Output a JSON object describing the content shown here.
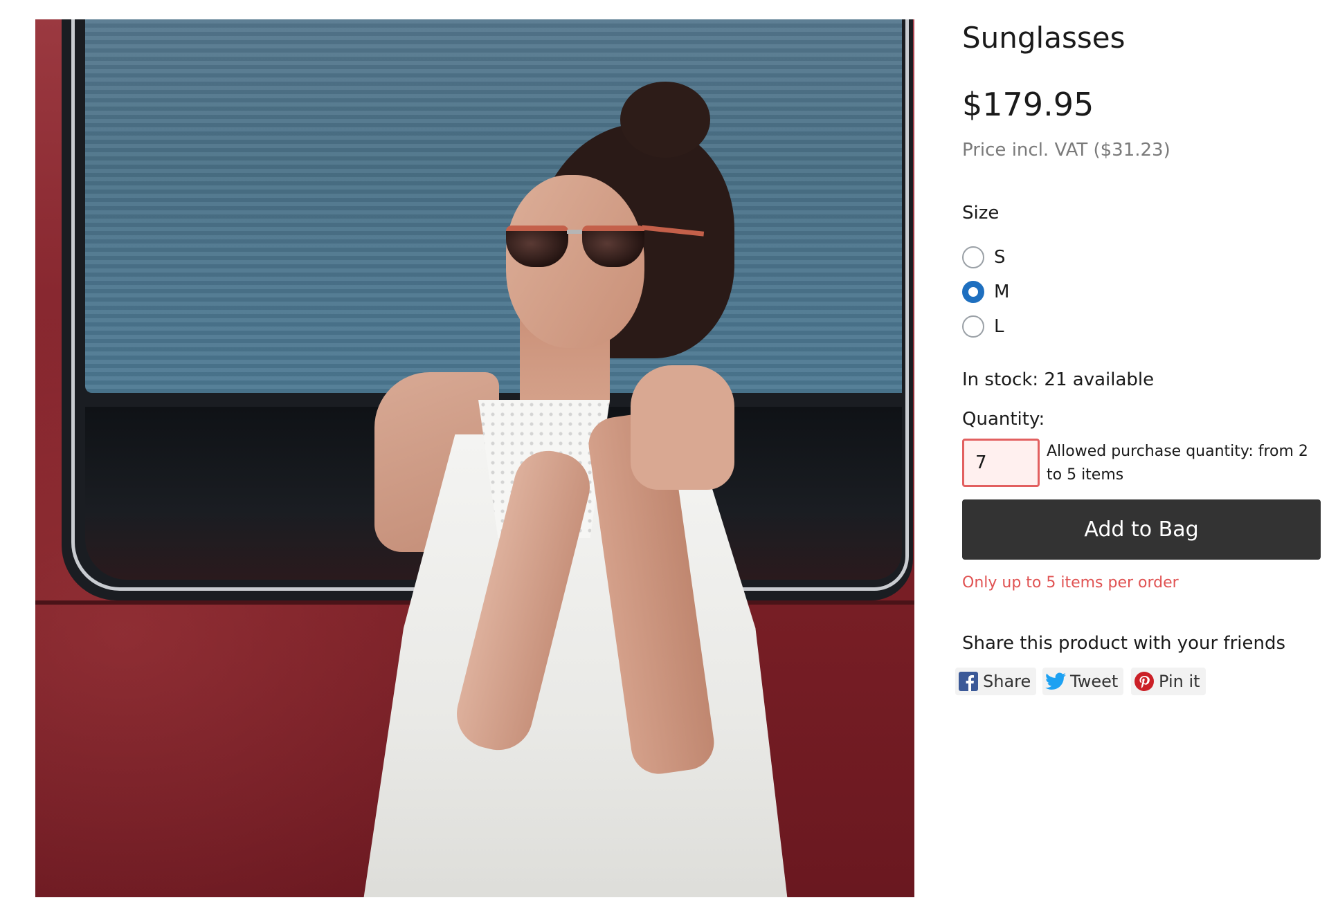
{
  "product": {
    "title": "Sunglasses",
    "price": "$179.95",
    "vat_note": "Price incl. VAT ($31.23)",
    "image_alt": "Woman in white dress wearing sunglasses leaning against a red van"
  },
  "size": {
    "label": "Size",
    "options": [
      {
        "label": "S",
        "selected": false
      },
      {
        "label": "M",
        "selected": true
      },
      {
        "label": "L",
        "selected": false
      }
    ]
  },
  "stock": {
    "text": "In stock: 21 available"
  },
  "quantity": {
    "label": "Quantity:",
    "value": "7",
    "hint": "Allowed purchase quantity: from 2 to 5 items"
  },
  "cart": {
    "add_label": "Add to Bag",
    "error": "Only up to 5 items per order"
  },
  "share": {
    "heading": "Share this product with your friends",
    "buttons": [
      {
        "label": "Share",
        "icon": "facebook-icon"
      },
      {
        "label": "Tweet",
        "icon": "twitter-icon"
      },
      {
        "label": "Pin it",
        "icon": "pinterest-icon"
      }
    ]
  },
  "colors": {
    "accent": "#1e6fbf",
    "button": "#333333",
    "error": "#e05252",
    "facebook": "#3b5998",
    "twitter": "#1da1f2",
    "pinterest": "#cb2027"
  }
}
